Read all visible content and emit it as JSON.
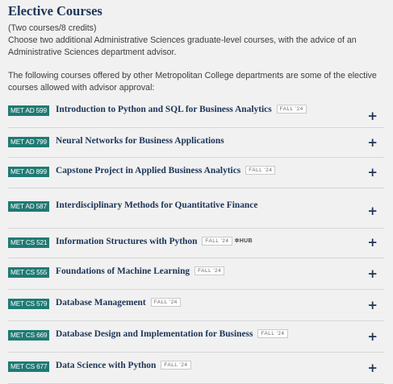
{
  "section": {
    "title": "Elective Courses",
    "line1": "(Two courses/8 credits)",
    "line2": "Choose two additional Administrative Sciences graduate-level courses, with the advice of an Administrative Sciences department advisor.",
    "line3": "The following courses offered by other Metropolitan College departments are some of the elective courses allowed with advisor approval:"
  },
  "colors": {
    "code_badge": "#1f7a73",
    "title": "#1c3557"
  },
  "courses": [
    {
      "code": "MET AD 599",
      "title": "Introduction to Python and SQL for Business Analytics",
      "term": "FALL '24",
      "extra": "",
      "icon": "plus-icon"
    },
    {
      "code": "MET AD 799",
      "title": "Neural Networks for Business Applications",
      "term": "",
      "extra": "",
      "icon": "plus-icon"
    },
    {
      "code": "MET AD 899",
      "title": "Capstone Project in Applied Business Analytics",
      "term": "FALL '24",
      "extra": "",
      "icon": "plus-icon"
    },
    {
      "code": "MET AD 587",
      "title": "Interdisciplinary Methods for Quantitative Finance",
      "term": "",
      "extra": "",
      "icon": "plus-icon"
    },
    {
      "code": "MET CS 521",
      "title": "Information Structures with Python",
      "term": "FALL '24",
      "extra": "✲HUB",
      "icon": "plus-icon"
    },
    {
      "code": "MET CS 555",
      "title": "Foundations of Machine Learning",
      "term": "FALL '24",
      "extra": "",
      "icon": "plus-icon"
    },
    {
      "code": "MET CS 579",
      "title": "Database Management",
      "term": "FALL '24",
      "extra": "",
      "icon": "plus-icon"
    },
    {
      "code": "MET CS 669",
      "title": "Database Design and Implementation for Business",
      "term": "FALL '24",
      "extra": "",
      "icon": "plus-icon"
    },
    {
      "code": "MET CS 677",
      "title": "Data Science with Python",
      "term": "FALL '24",
      "extra": "",
      "icon": "plus-icon"
    }
  ]
}
